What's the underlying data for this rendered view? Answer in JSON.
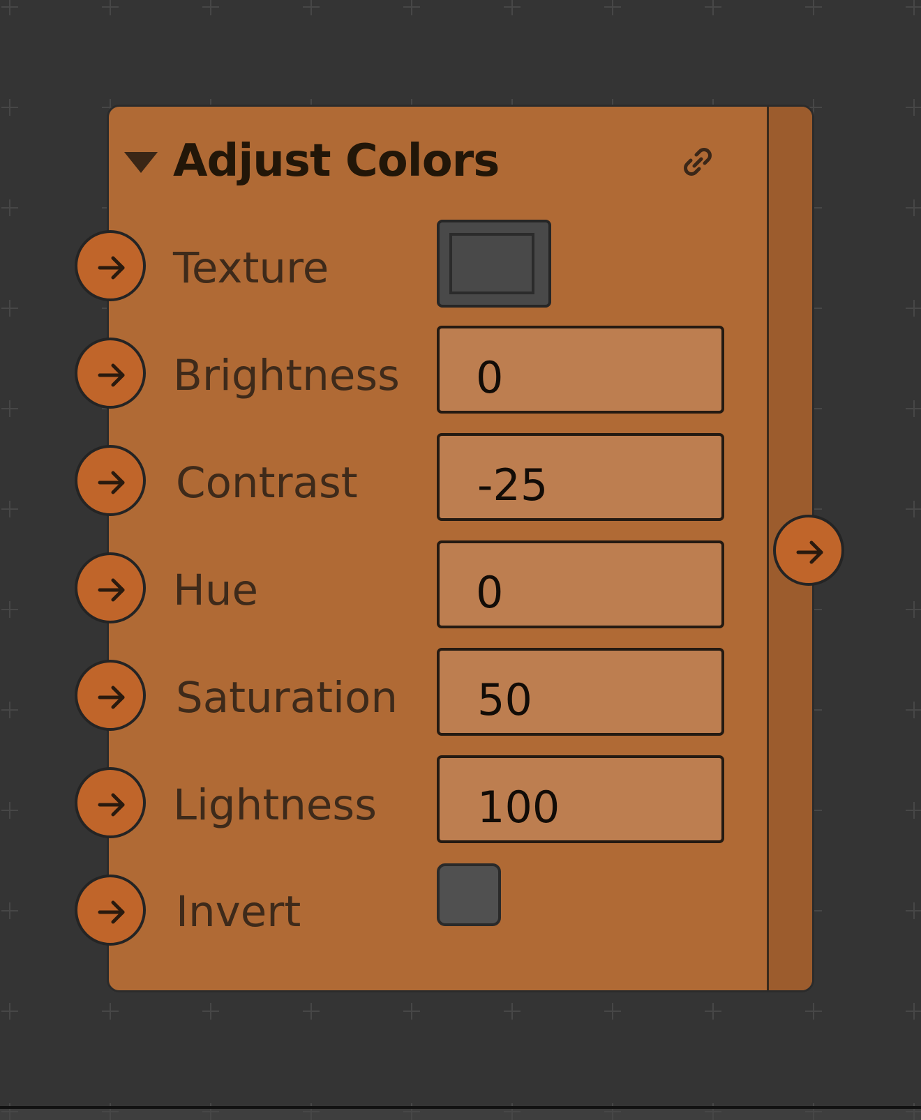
{
  "node": {
    "title": "Adjust Colors",
    "color": "#b06a35",
    "header_icons": [
      "collapse-triangle-icon",
      "link-icon"
    ]
  },
  "inputs": {
    "texture": {
      "label": "Texture",
      "value_kind": "texture-swatch"
    },
    "brightness": {
      "label": "Brightness",
      "value": "0"
    },
    "contrast": {
      "label": "Contrast",
      "value": "-25"
    },
    "hue": {
      "label": "Hue",
      "value": "0"
    },
    "saturation": {
      "label": "Saturation",
      "value": "50"
    },
    "lightness": {
      "label": "Lightness",
      "value": "100"
    },
    "invert": {
      "label": "Invert",
      "checked": false
    }
  },
  "ports": {
    "input_icon": "arrow-right-icon",
    "output_icon": "arrow-right-icon",
    "color": "#c0652a"
  },
  "canvas": {
    "background": "#343434",
    "grid_mark_color": "#474747"
  }
}
